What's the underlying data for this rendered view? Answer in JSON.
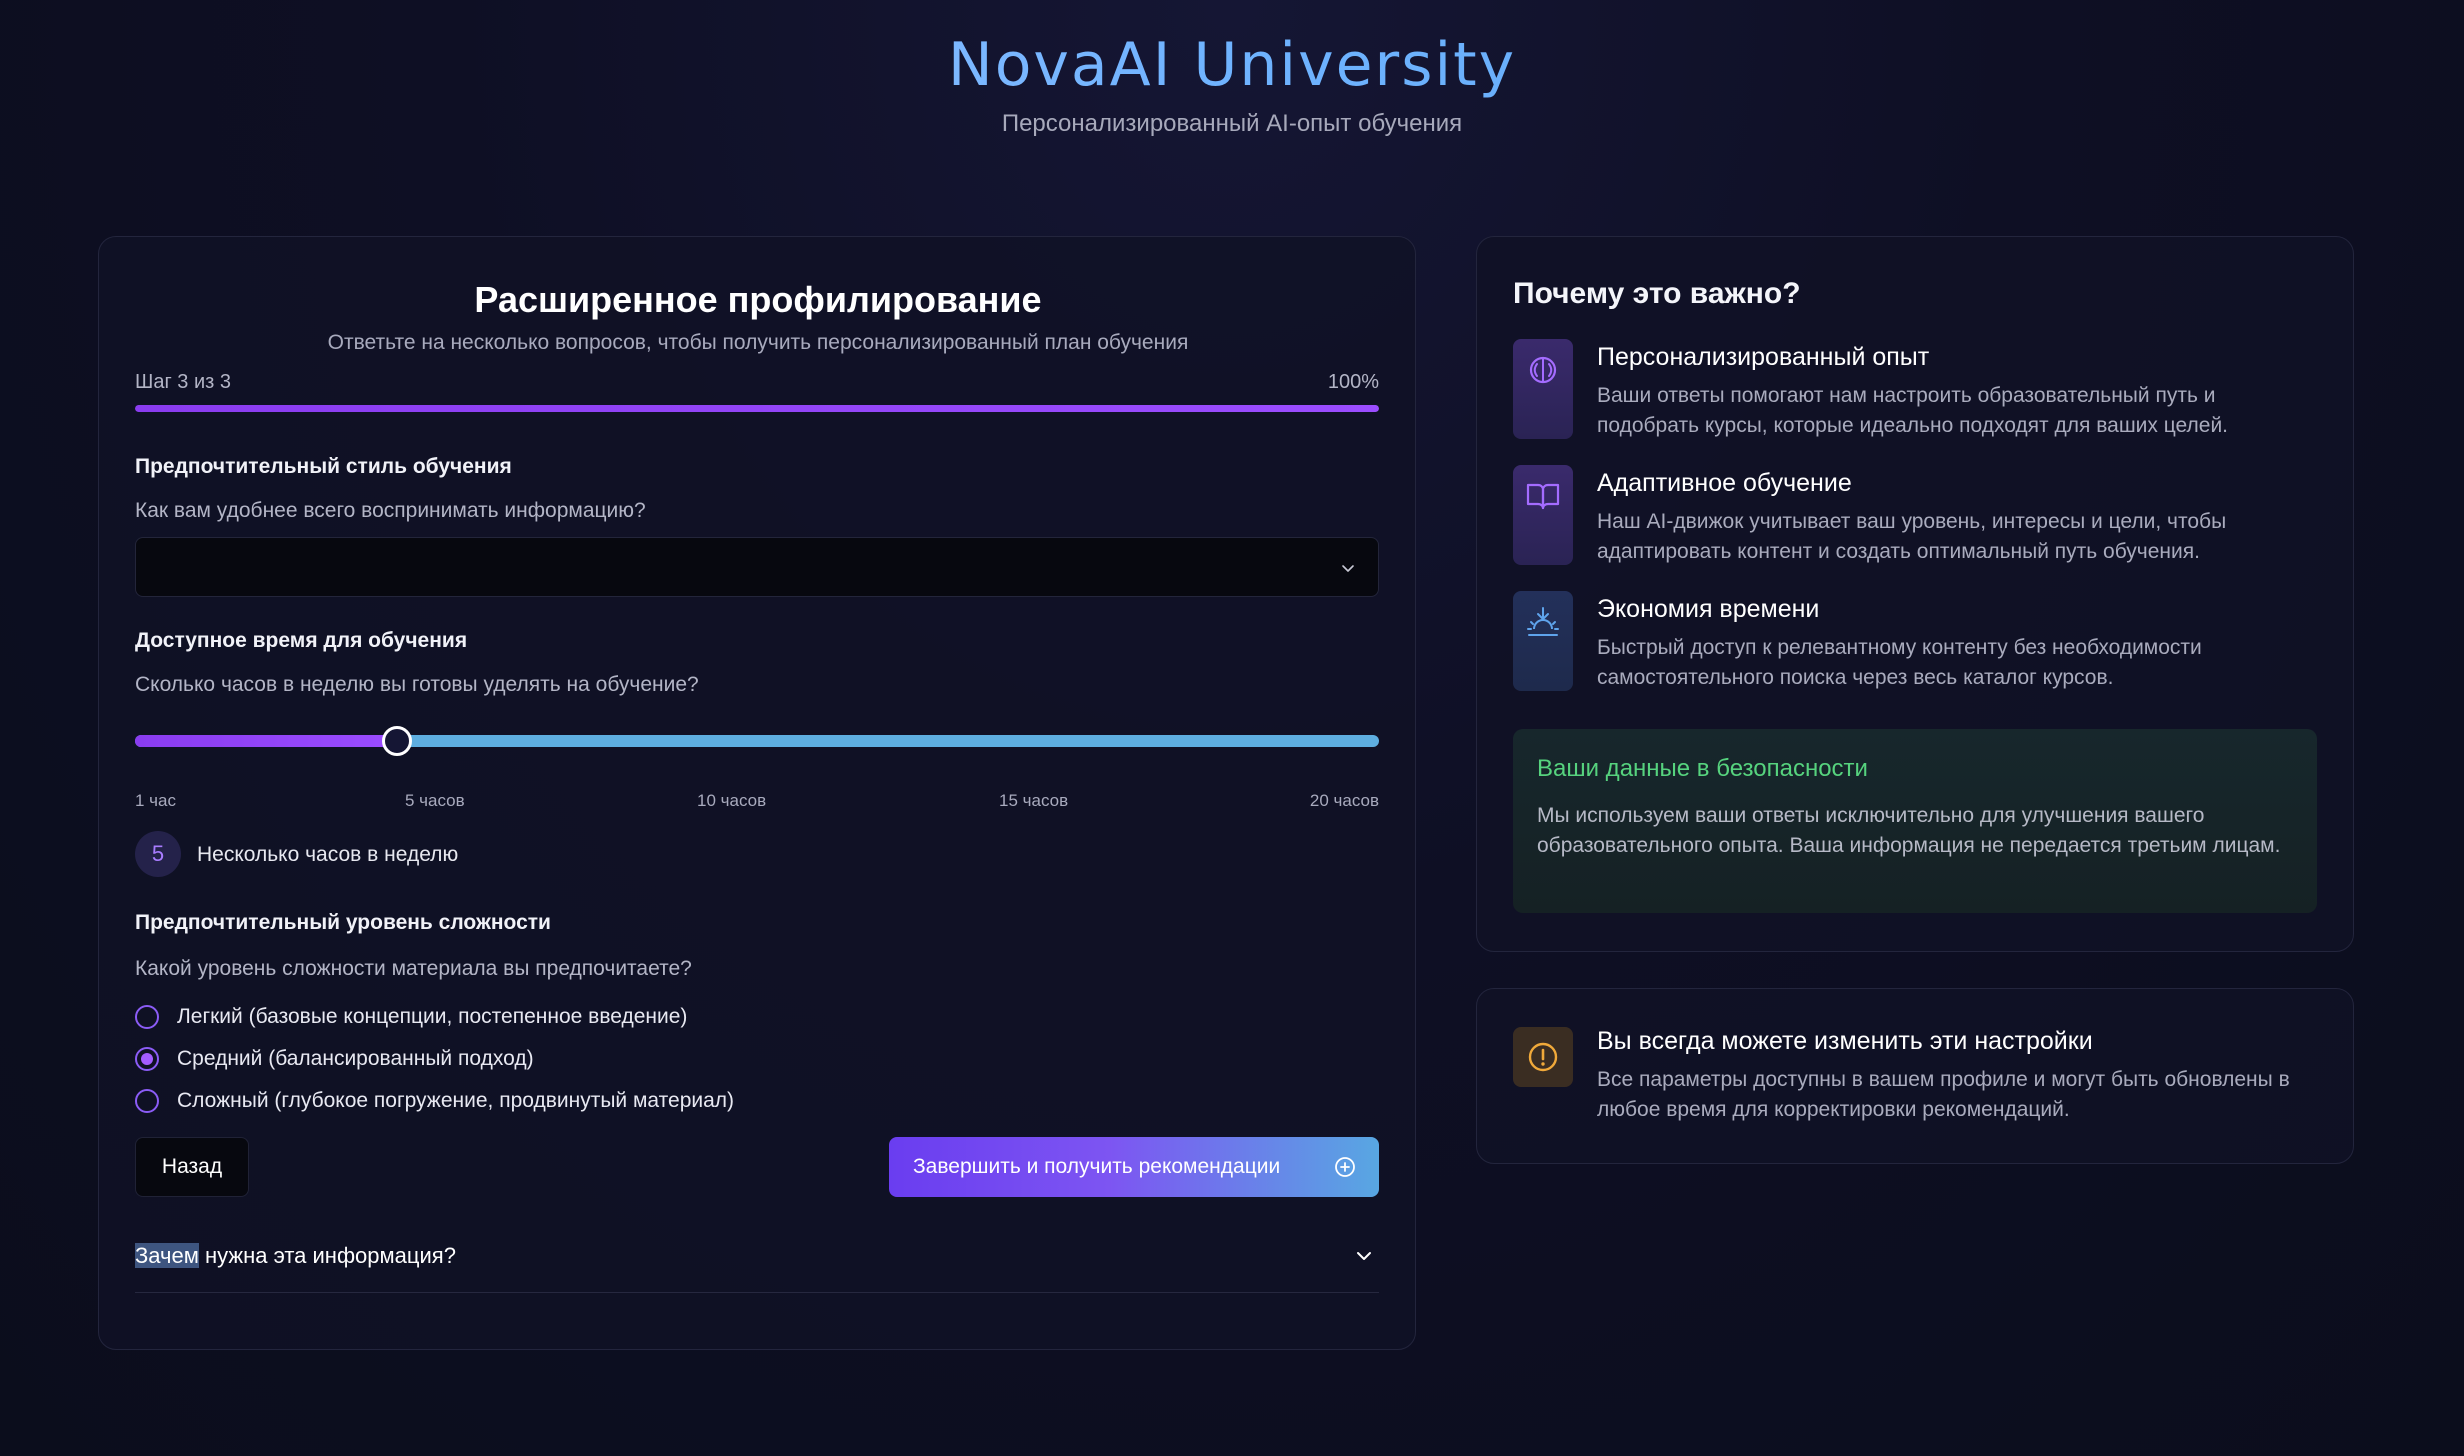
{
  "header": {
    "brand": "NovaAI University",
    "tagline": "Персонализированный AI-опыт обучения"
  },
  "form": {
    "title": "Расширенное профилирование",
    "subtitle": "Ответьте на несколько вопросов, чтобы получить персонализированный план обучения",
    "step_label": "Шаг 3 из 3",
    "progress_label": "100%",
    "progress_value": 1.0,
    "style": {
      "label": "Предпочтительный стиль обучения",
      "hint": "Как вам удобнее всего воспринимать информацию?",
      "selected": ""
    },
    "time": {
      "label": "Доступное время для обучения",
      "hint": "Сколько часов в неделю вы готовы уделять на обучение?",
      "min": 1,
      "max": 20,
      "value": 5,
      "ticks": [
        "1 час",
        "5 часов",
        "10 часов",
        "15 часов",
        "20 часов"
      ],
      "badge": "5",
      "value_text": "Несколько часов в неделю"
    },
    "difficulty": {
      "label": "Предпочтительный уровень сложности",
      "hint": "Какой уровень сложности материала вы предпочитаете?",
      "options": [
        {
          "label": "Легкий (базовые концепции, постепенное введение)",
          "checked": false
        },
        {
          "label": "Средний (балансированный подход)",
          "checked": true
        },
        {
          "label": "Сложный (глубокое погружение, продвинутый материал)",
          "checked": false
        }
      ]
    },
    "back_label": "Назад",
    "finish_label": "Завершить и получить рекомендации",
    "accordion": {
      "highlighted": "Зачем",
      "rest": " нужна эта информация?"
    }
  },
  "why": {
    "title": "Почему это важно?",
    "features": [
      {
        "icon": "brain-icon",
        "title": "Персонализированный опыт",
        "desc": "Ваши ответы помогают нам настроить образовательный путь и подобрать курсы, которые идеально подходят для ваших целей."
      },
      {
        "icon": "book-icon",
        "title": "Адаптивное обучение",
        "desc": "Наш AI-движок учитывает ваш уровень, интересы и цели, чтобы адаптировать контент и создать оптимальный путь обучения."
      },
      {
        "icon": "sunrise-icon",
        "title": "Экономия времени",
        "desc": "Быстрый доступ к релевантному контенту без необходимости самостоятельного поиска через весь каталог курсов."
      }
    ],
    "safe_title": "Ваши данные в безопасности",
    "safe_text": "Мы используем ваши ответы исключительно для улучшения вашего образовательного опыта. Ваша информация не передается третьим лицам."
  },
  "note": {
    "icon": "alert-circle-icon",
    "title": "Вы всегда можете изменить эти настройки",
    "desc": "Все параметры доступны в вашем профиле и могут быть обновлены в любое время для корректировки рекомендаций."
  },
  "colors": {
    "accent": "#8b5cf6",
    "slider_rest": "#5eaee0",
    "safe_green": "#56d37e",
    "background": "#0d0f1f"
  }
}
